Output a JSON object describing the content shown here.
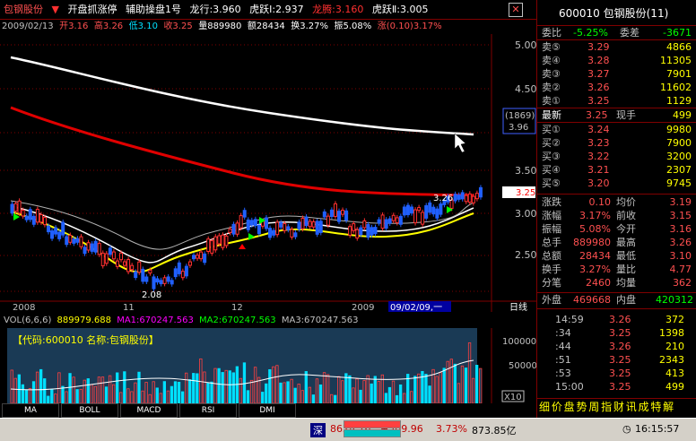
{
  "header": {
    "stock_name": "包钢股份",
    "indicator_name": "开盘抓涨停",
    "indicator_sub": "辅助操盘1号",
    "longxing": "龙行:3.960",
    "huyue1": "虎跃Ⅰ:2.937",
    "longteng": "龙腾:3.160",
    "huyue2": "虎跃Ⅱ:3.005",
    "close_icon": "close-icon"
  },
  "quote_line": {
    "date": "2009/02/13",
    "open": "开3.16",
    "high": "高3.26",
    "low": "低3.10",
    "close": "收3.25",
    "volume": "量889980",
    "amount": "额28434",
    "turnover": "换3.27%",
    "amplitude": "振5.08%",
    "change": "涨(0.10)3.17%"
  },
  "axis": {
    "price_labels": [
      "5.00",
      "4.50",
      "3.50",
      "3.00",
      "2.50"
    ],
    "cursor_label_top": "(1869)",
    "cursor_label_bottom": "3.96",
    "last_price_tag": "3.25",
    "high_annotation": "3.26",
    "low_annotation": "2.08",
    "x_labels": [
      "2008",
      "11",
      "12",
      "2009",
      "09/02/09,一"
    ],
    "rixian": "日线",
    "vol_label_top": "100000",
    "vol_label_mid": "50000",
    "vol_unit": "X10"
  },
  "vol_header": {
    "name": "VOL(6,6,6)",
    "vol": "889979.688",
    "ma1": "MA1:670247.563",
    "ma2": "MA2:670247.563",
    "ma3": "MA3:670247.563"
  },
  "vol_info": "【代码:600010 名称:包钢股份】",
  "indicator_tabs": [
    "MA",
    "BOLL",
    "MACD",
    "RSI",
    "DMI"
  ],
  "right_panel": {
    "code_name": "600010 包钢股份(11)",
    "weibi_label": "委比",
    "weibi_value": "-5.25%",
    "weicha_label": "委差",
    "weicha_value": "-3671",
    "sell": [
      {
        "label": "卖⑤",
        "price": "3.29",
        "vol": "4866"
      },
      {
        "label": "卖④",
        "price": "3.28",
        "vol": "11305"
      },
      {
        "label": "卖③",
        "price": "3.27",
        "vol": "7901"
      },
      {
        "label": "卖②",
        "price": "3.26",
        "vol": "11602"
      },
      {
        "label": "卖①",
        "price": "3.25",
        "vol": "1129"
      }
    ],
    "latest_label": "最新",
    "latest_value": "3.25",
    "xianshou_label": "现手",
    "xianshou_value": "499",
    "buy": [
      {
        "label": "买①",
        "price": "3.24",
        "vol": "9980"
      },
      {
        "label": "买②",
        "price": "3.23",
        "vol": "7900"
      },
      {
        "label": "买③",
        "price": "3.22",
        "vol": "3200"
      },
      {
        "label": "买④",
        "price": "3.21",
        "vol": "2307"
      },
      {
        "label": "买⑤",
        "price": "3.20",
        "vol": "9745"
      }
    ],
    "stats": [
      {
        "l1": "涨跌",
        "v1": "0.10",
        "l2": "均价",
        "v2": "3.19"
      },
      {
        "l1": "涨幅",
        "v1": "3.17%",
        "l2": "前收",
        "v2": "3.15"
      },
      {
        "l1": "振幅",
        "v1": "5.08%",
        "l2": "今开",
        "v2": "3.16"
      },
      {
        "l1": "总手",
        "v1": "889980",
        "l2": "最高",
        "v2": "3.26"
      },
      {
        "l1": "总额",
        "v1": "28434",
        "l2": "最低",
        "v2": "3.10"
      },
      {
        "l1": "换手",
        "v1": "3.27%",
        "l2": "量比",
        "v2": "4.77"
      },
      {
        "l1": "分笔",
        "v1": "2460",
        "l2": "均量",
        "v2": "362"
      }
    ],
    "waipan_label": "外盘",
    "waipan_value": "469668",
    "neipan_label": "内盘",
    "neipan_value": "420312",
    "ticks": [
      {
        "time": "14:59",
        "price": "3.26",
        "vol": "372"
      },
      {
        "time": ":34",
        "price": "3.25",
        "vol": "1398"
      },
      {
        "time": ":44",
        "price": "3.26",
        "vol": "210"
      },
      {
        "time": ":51",
        "price": "3.25",
        "vol": "2343"
      },
      {
        "time": ":53",
        "price": "3.25",
        "vol": "413"
      },
      {
        "time": "15:00",
        "price": "3.25",
        "vol": "499"
      }
    ],
    "tabs_text": "细 价 盘 势 周 指 财 讯 成 特 解"
  },
  "status": {
    "market": "深",
    "index": "8628.76",
    "change": "+309.96",
    "pct": "3.73%",
    "amount": "873.85亿",
    "time": "16:15:57"
  }
}
